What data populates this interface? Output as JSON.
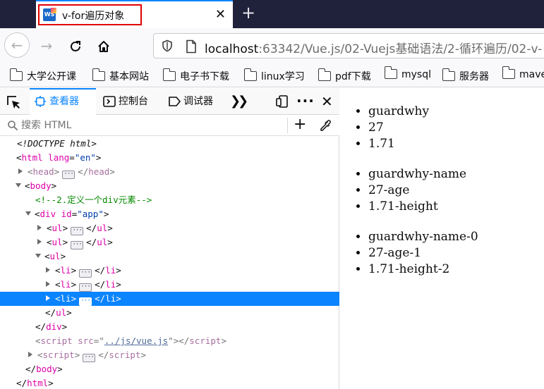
{
  "tab": {
    "title": "v-for遍历对象",
    "favicon": "WS"
  },
  "nav": {
    "url_host": "localhost",
    "url_rest": ":63342/Vue.js/02-Vuejs基础语法/2-循环遍历/02-v-"
  },
  "bookmarks": [
    "大学公开课",
    "基本网站",
    "电子书下载",
    "linux学习",
    "pdf下载",
    "mysql",
    "服务器",
    "mave"
  ],
  "devtools": {
    "tabs": {
      "inspector": "查看器",
      "console": "控制台",
      "debugger": "调试器"
    },
    "search_placeholder": "搜索 HTML",
    "dom": {
      "doctype": "<!DOCTYPE html>",
      "html_tag": "html",
      "lang_attr": "lang",
      "lang_val": "\"en\"",
      "head_tag": "head",
      "body_tag": "body",
      "comment": "<!--2.定义一个div元素-->",
      "div_tag": "div",
      "id_attr": "id",
      "id_val": "\"app\"",
      "ul_tag": "ul",
      "li_tag": "li",
      "script_tag": "script",
      "src_attr": "src",
      "src_val": "../js/vue.js"
    }
  },
  "page": {
    "lists": [
      [
        "guardwhy",
        "27",
        "1.71"
      ],
      [
        "guardwhy-name",
        "27-age",
        "1.71-height"
      ],
      [
        "guardwhy-name-0",
        "27-age-1",
        "1.71-height-2"
      ]
    ]
  },
  "colors": {
    "accent": "#0a84ff",
    "tab_outline": "#e00000",
    "titlebar": "#20213a"
  }
}
